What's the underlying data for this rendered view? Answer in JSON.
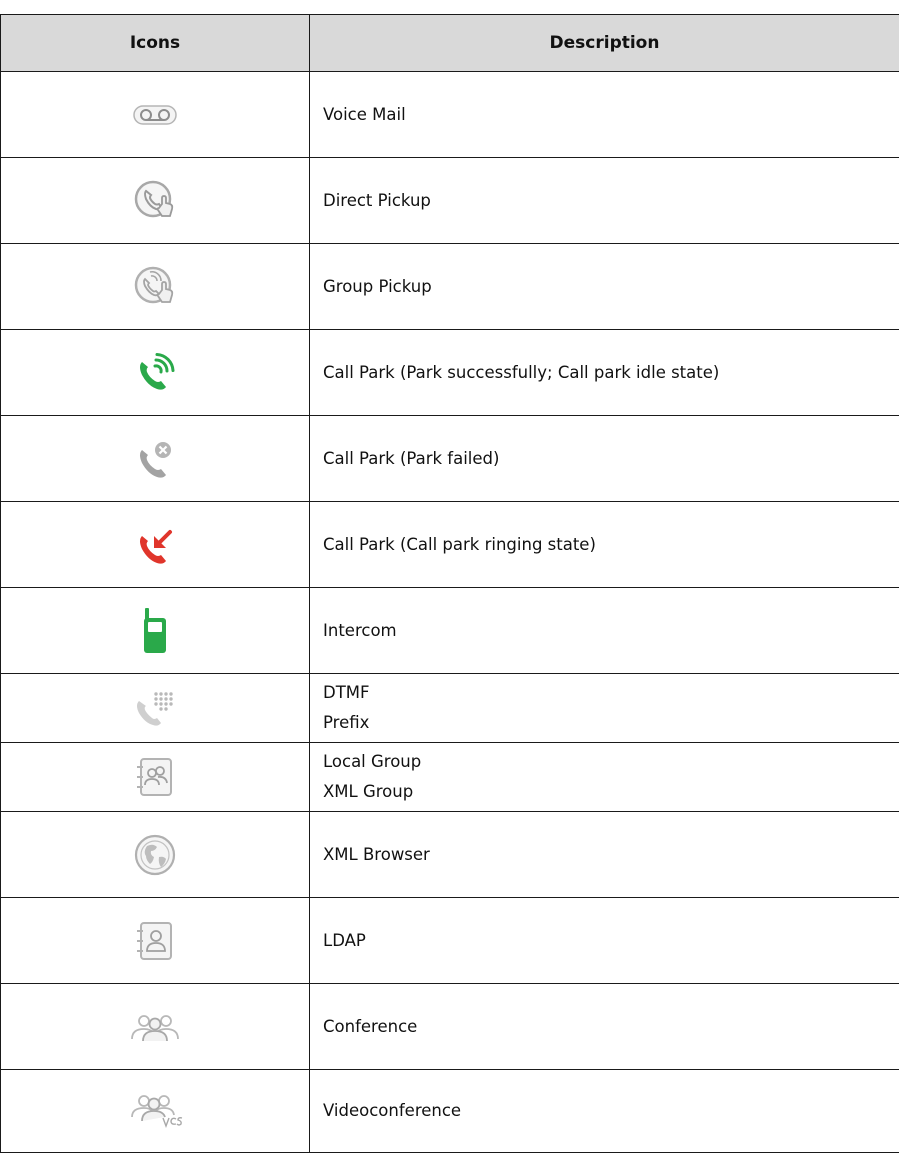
{
  "table": {
    "headers": {
      "icons": "Icons",
      "description": "Description"
    },
    "rows": [
      {
        "icon": "voicemail-icon",
        "lines": [
          "Voice Mail"
        ]
      },
      {
        "icon": "direct-pickup-icon",
        "lines": [
          "Direct Pickup"
        ]
      },
      {
        "icon": "group-pickup-icon",
        "lines": [
          "Group Pickup"
        ]
      },
      {
        "icon": "call-park-success-icon",
        "lines": [
          "Call Park (Park successfully; Call park idle state)"
        ]
      },
      {
        "icon": "call-park-failed-icon",
        "lines": [
          "Call Park (Park failed)"
        ]
      },
      {
        "icon": "call-park-ringing-icon",
        "lines": [
          "Call Park (Call park ringing state)"
        ]
      },
      {
        "icon": "intercom-icon",
        "lines": [
          "Intercom"
        ]
      },
      {
        "icon": "dtmf-icon",
        "lines": [
          "DTMF",
          "Prefix"
        ]
      },
      {
        "icon": "group-contacts-icon",
        "lines": [
          "Local Group",
          "XML Group"
        ]
      },
      {
        "icon": "globe-icon",
        "lines": [
          "XML Browser"
        ]
      },
      {
        "icon": "contact-book-icon",
        "lines": [
          "LDAP"
        ]
      },
      {
        "icon": "conference-icon",
        "lines": [
          "Conference"
        ]
      },
      {
        "icon": "videoconference-icon",
        "lines": [
          "Videoconference"
        ]
      }
    ]
  },
  "colors": {
    "header_bg": "#d9d9d9",
    "icon_grey": "#9a9a9a",
    "icon_green": "#2aa94a",
    "icon_red": "#e0352b"
  }
}
